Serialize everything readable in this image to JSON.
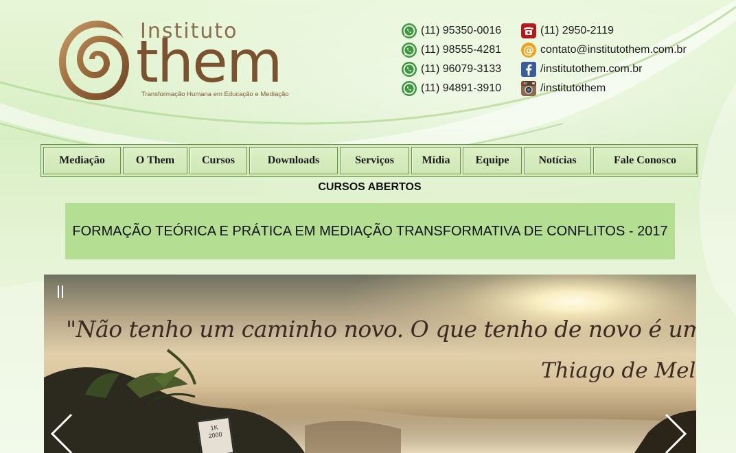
{
  "logo": {
    "line1": "Instituto",
    "line2": "them",
    "tagline": "Transformação Humana em Educação e Mediação",
    "colors": {
      "brown": "#7a5230",
      "gold": "#c49a64"
    }
  },
  "contacts": {
    "left": [
      {
        "icon": "whatsapp-icon",
        "text": "(11) 95350-0016"
      },
      {
        "icon": "whatsapp-icon",
        "text": "(11) 98555-4281"
      },
      {
        "icon": "whatsapp-icon",
        "text": "(11) 96079-3133"
      },
      {
        "icon": "whatsapp-icon",
        "text": "(11) 94891-3910"
      }
    ],
    "right": [
      {
        "icon": "telephone-icon",
        "text": "(11) 2950-2119"
      },
      {
        "icon": "email-icon",
        "text": "contato@institutothem.com.br"
      },
      {
        "icon": "facebook-icon",
        "text": "/institutothem.com.br"
      },
      {
        "icon": "instagram-icon",
        "text": "/institutothem"
      }
    ]
  },
  "nav": {
    "items": [
      {
        "label": "Mediação"
      },
      {
        "label": "O Them"
      },
      {
        "label": "Cursos"
      },
      {
        "label": "Downloads"
      },
      {
        "label": "Serviços"
      },
      {
        "label": "Mídia"
      },
      {
        "label": "Equipe"
      },
      {
        "label": "Notícias"
      },
      {
        "label": "Fale Conosco"
      }
    ]
  },
  "courses": {
    "title": "CURSOS ABERTOS",
    "featured": "FORMAÇÃO TEÓRICA E PRÁTICA EM MEDIAÇÃO TRANSFORMATIVA DE CONFLITOS - 2017"
  },
  "slider": {
    "quote": "\"Não tenho um caminho novo. O que tenho de novo é um jeito de caminhar\"",
    "author": "Thiago de Mello",
    "sign_text": "1K 2000"
  }
}
